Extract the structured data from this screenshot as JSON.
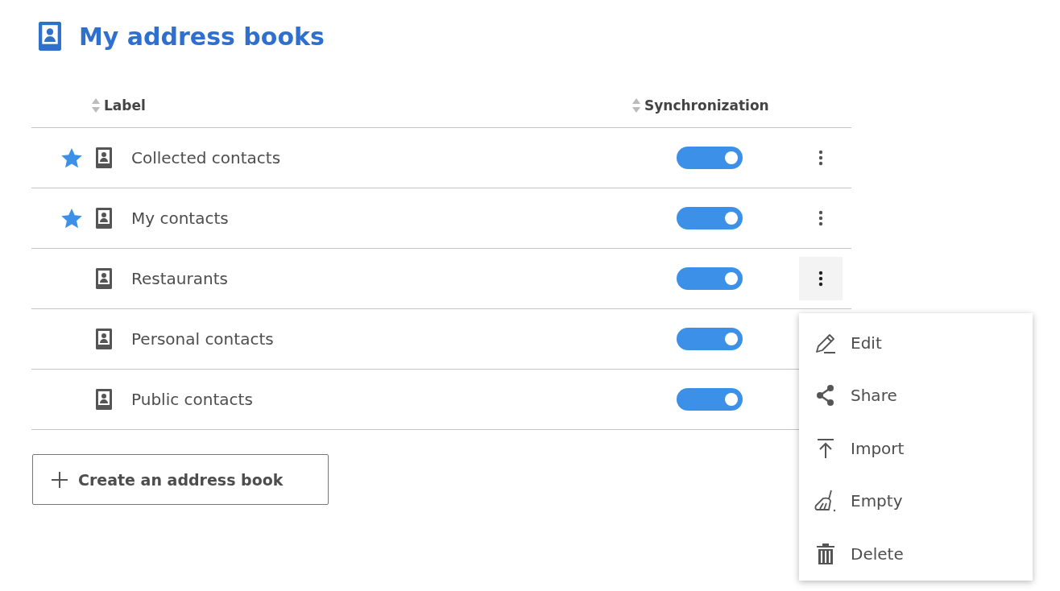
{
  "title": "My address books",
  "table": {
    "columns": [
      {
        "label": "Label"
      },
      {
        "label": "Synchronization"
      }
    ],
    "rows": [
      {
        "label": "Collected contacts",
        "favorite": true,
        "sync": true,
        "menu_open": false
      },
      {
        "label": "My contacts",
        "favorite": true,
        "sync": true,
        "menu_open": false
      },
      {
        "label": "Restaurants",
        "favorite": false,
        "sync": true,
        "menu_open": true
      },
      {
        "label": "Personal contacts",
        "favorite": false,
        "sync": true,
        "menu_open": false
      },
      {
        "label": "Public contacts",
        "favorite": false,
        "sync": true,
        "menu_open": false
      }
    ]
  },
  "create_button": {
    "label": "Create an address book"
  },
  "menu": {
    "items": [
      {
        "label": "Edit",
        "kind": "edit"
      },
      {
        "label": "Share",
        "kind": "share"
      },
      {
        "label": "Import",
        "kind": "import"
      },
      {
        "label": "Empty",
        "kind": "empty"
      },
      {
        "label": "Delete",
        "kind": "delete"
      }
    ]
  }
}
